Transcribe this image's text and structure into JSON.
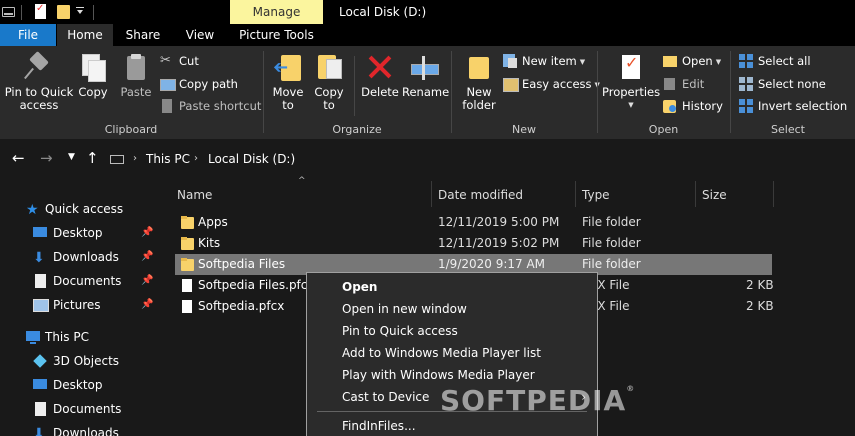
{
  "titlebar": {
    "manage_tab": "Manage",
    "window_title": "Local Disk (D:)",
    "accent_color": "#fbf59e"
  },
  "tabs": [
    {
      "label": "File"
    },
    {
      "label": "Home"
    },
    {
      "label": "Share"
    },
    {
      "label": "View"
    },
    {
      "label": "Picture Tools"
    }
  ],
  "ribbon": {
    "clipboard": {
      "label": "Clipboard",
      "pin": "Pin to Quick access",
      "copy": "Copy",
      "paste": "Paste",
      "cut": "Cut",
      "copy_path": "Copy path",
      "paste_shortcut": "Paste shortcut"
    },
    "organize": {
      "label": "Organize",
      "move_to": "Move to",
      "copy_to": "Copy to",
      "delete": "Delete",
      "rename": "Rename"
    },
    "new": {
      "label": "New",
      "new_folder": "New folder",
      "new_item": "New item",
      "easy_access": "Easy access"
    },
    "open": {
      "label": "Open",
      "properties": "Properties",
      "open": "Open",
      "edit": "Edit",
      "history": "History"
    },
    "select": {
      "label": "Select",
      "select_all": "Select all",
      "select_none": "Select none",
      "invert_selection": "Invert selection"
    }
  },
  "address": {
    "crumbs": [
      "This PC",
      "Local Disk (D:)"
    ]
  },
  "navpane": {
    "quick_access": "Quick access",
    "quick_items": [
      "Desktop",
      "Downloads",
      "Documents",
      "Pictures"
    ],
    "this_pc": "This PC",
    "pc_items": [
      "3D Objects",
      "Desktop",
      "Documents",
      "Downloads"
    ]
  },
  "columns": {
    "name": "Name",
    "date": "Date modified",
    "type": "Type",
    "size": "Size"
  },
  "files": [
    {
      "name": "Apps",
      "date": "12/11/2019 5:00 PM",
      "type": "File folder",
      "size": "",
      "kind": "folder"
    },
    {
      "name": "Kits",
      "date": "12/11/2019 5:02 PM",
      "type": "File folder",
      "size": "",
      "kind": "folder"
    },
    {
      "name": "Softpedia Files",
      "date": "1/9/2020 9:17 AM",
      "type": "File folder",
      "size": "",
      "kind": "folder"
    },
    {
      "name": "Softpedia Files.pfcx",
      "date": "",
      "type": "CX File",
      "size": "2 KB",
      "kind": "file"
    },
    {
      "name": "Softpedia.pfcx",
      "date": "",
      "type": "CX File",
      "size": "2 KB",
      "kind": "file"
    }
  ],
  "context_menu": {
    "items": [
      "Open",
      "Open in new window",
      "Pin to Quick access",
      "Add to Windows Media Player list",
      "Play with Windows Media Player",
      "Cast to Device",
      "FindInFiles..."
    ]
  },
  "watermark": "SOFTPEDIA"
}
